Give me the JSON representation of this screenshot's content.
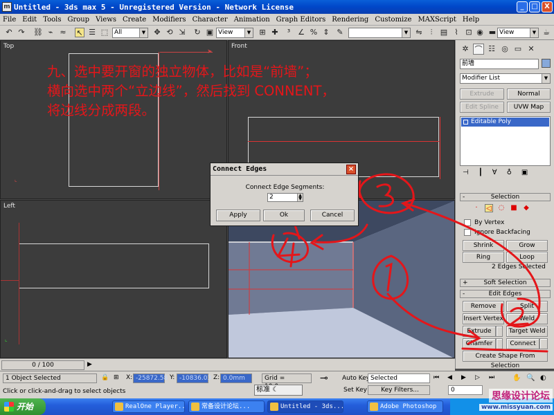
{
  "window": {
    "title": "Untitled - 3ds max 5 - Unregistered Version - Network License",
    "min": "_",
    "max": "□",
    "close": "X"
  },
  "menu": [
    "File",
    "Edit",
    "Tools",
    "Group",
    "Views",
    "Create",
    "Modifiers",
    "Character",
    "Animation",
    "Graph Editors",
    "Rendering",
    "Customize",
    "MAXScript",
    "Help"
  ],
  "toolbar": {
    "selection_filter": "All",
    "ref_coord": "View",
    "named_selection": "",
    "view_right": "View"
  },
  "viewports": {
    "top": "Top",
    "front": "Front",
    "left": "Left"
  },
  "annotation": {
    "line1": "九、选中要开窗的独立物体，比如是“前墙”；",
    "line2": "横向选中两个“立边线”，然后找到 CONNENT，",
    "line3": "将边线分成两段。"
  },
  "dialog": {
    "title": "Connect Edges",
    "label": "Connect Edge Segments:",
    "segments": "2",
    "apply": "Apply",
    "ok": "Ok",
    "cancel": "Cancel"
  },
  "command_panel": {
    "object_name": "前墙",
    "modifier_list": "Modifier List",
    "btn_extrude": "Extrude",
    "btn_normal": "Normal",
    "btn_edit_spline": "Edit Spline",
    "btn_uvw_map": "UVW Map",
    "stack_item": "Editable Poly",
    "rollout_selection": "Selection",
    "by_vertex": "By Vertex",
    "ignore_backfacing": "Ignore Backfacing",
    "shrink": "Shrink",
    "grow": "Grow",
    "ring": "Ring",
    "loop": "Loop",
    "edges_selected": "2 Edges Selected",
    "rollout_soft": "Soft Selection",
    "rollout_edit_edges": "Edit Edges",
    "remove": "Remove",
    "split": "Split",
    "insert_vertex": "Insert Vertex",
    "weld": "Weld",
    "extrude": "Extrude",
    "target_weld": "Target Weld",
    "chamfer": "Chamfer",
    "connect": "Connect",
    "create_shape": "Create Shape From Selection"
  },
  "timeline": {
    "frame": "0 / 100"
  },
  "status": {
    "objects_selected": "1 Object Selected",
    "prompt": "Click or click-and-drag to select objects",
    "x_label": "X:",
    "x_value": "-25872.58",
    "y_label": "Y:",
    "y_value": "-10836.03",
    "z_label": "Z:",
    "z_value": "0.0mm",
    "grid": "Grid = 10.0mm",
    "auto_key": "Auto Key",
    "set_key": "Set Key",
    "key_mode": "Selected",
    "key_filters": "Key Filters...",
    "frame_field": "0"
  },
  "ime": {
    "text": "标准"
  },
  "taskbar": {
    "start": "开始",
    "tasks": [
      "RealOne Player...",
      "常备设计论坛...",
      "Untitled - 3ds...",
      "Adobe Photoshop"
    ]
  },
  "watermark": {
    "text": "思缘设计论坛",
    "url": "www.missyuan.com"
  },
  "colors": {
    "annotation": "#e4161a",
    "titlebar": "#0a5fd8",
    "panel": "#d6d3ce",
    "viewport": "#3c3c3c",
    "selected_blue": "#3a68c8"
  }
}
